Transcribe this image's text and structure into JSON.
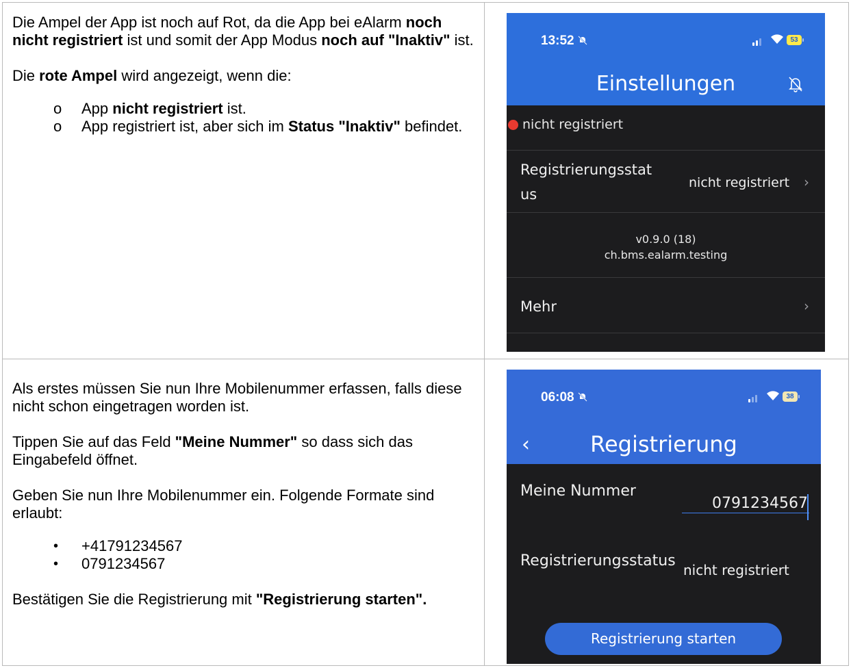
{
  "row1": {
    "text": {
      "p1": {
        "a": "Die Ampel der App ist noch auf Rot, da die App bei eAlarm ",
        "b1": "noch nicht registriert",
        "c": " ist und somit der App Modus ",
        "b2": "noch auf \"Inaktiv\"",
        "d": " ist."
      },
      "p2": {
        "a": "Die ",
        "b": "rote Ampel",
        "c": " wird angezeigt, wenn die:"
      },
      "list_marker": "o",
      "items": [
        {
          "a": "App ",
          "b": "nicht registriert",
          "c": " ist."
        },
        {
          "a": "App registriert ist, aber sich im ",
          "b": "Status \"Inaktiv\"",
          "c": " befindet."
        }
      ]
    },
    "phone": {
      "time": "13:52",
      "battery": "53",
      "title": "Einstellungen",
      "status_text": "nicht registriert",
      "reg_label": "Registrierungsstatus",
      "reg_value": "nicht registriert",
      "version": "v0.9.0 (18)",
      "bundle": "ch.bms.ealarm.testing",
      "more_label": "Mehr",
      "chevron": "›"
    }
  },
  "row2": {
    "text": {
      "p1": "Als erstes müssen Sie nun Ihre Mobilenummer erfassen, falls diese nicht schon eingetragen worden ist.",
      "p2": {
        "a": "Tippen Sie auf das Feld ",
        "b": "\"Meine Nummer\"",
        "c": " so dass sich das Eingabefeld öffnet."
      },
      "p3": "Geben Sie nun Ihre Mobilenummer ein. Folgende Formate sind erlaubt:",
      "bullet": "•",
      "formats": [
        "+41791234567",
        "0791234567"
      ],
      "p4": {
        "a": "Bestätigen Sie die Registrierung mit ",
        "b": "\"Registrierung starten\"."
      }
    },
    "phone": {
      "time": "06:08",
      "battery": "38",
      "back": "‹",
      "title": "Registrierung",
      "number_label": "Meine Nummer",
      "number_value": "0791234567",
      "reg_label": "Registrierungsstatus",
      "reg_value": "nicht registriert",
      "start_button": "Registrierung starten"
    }
  }
}
